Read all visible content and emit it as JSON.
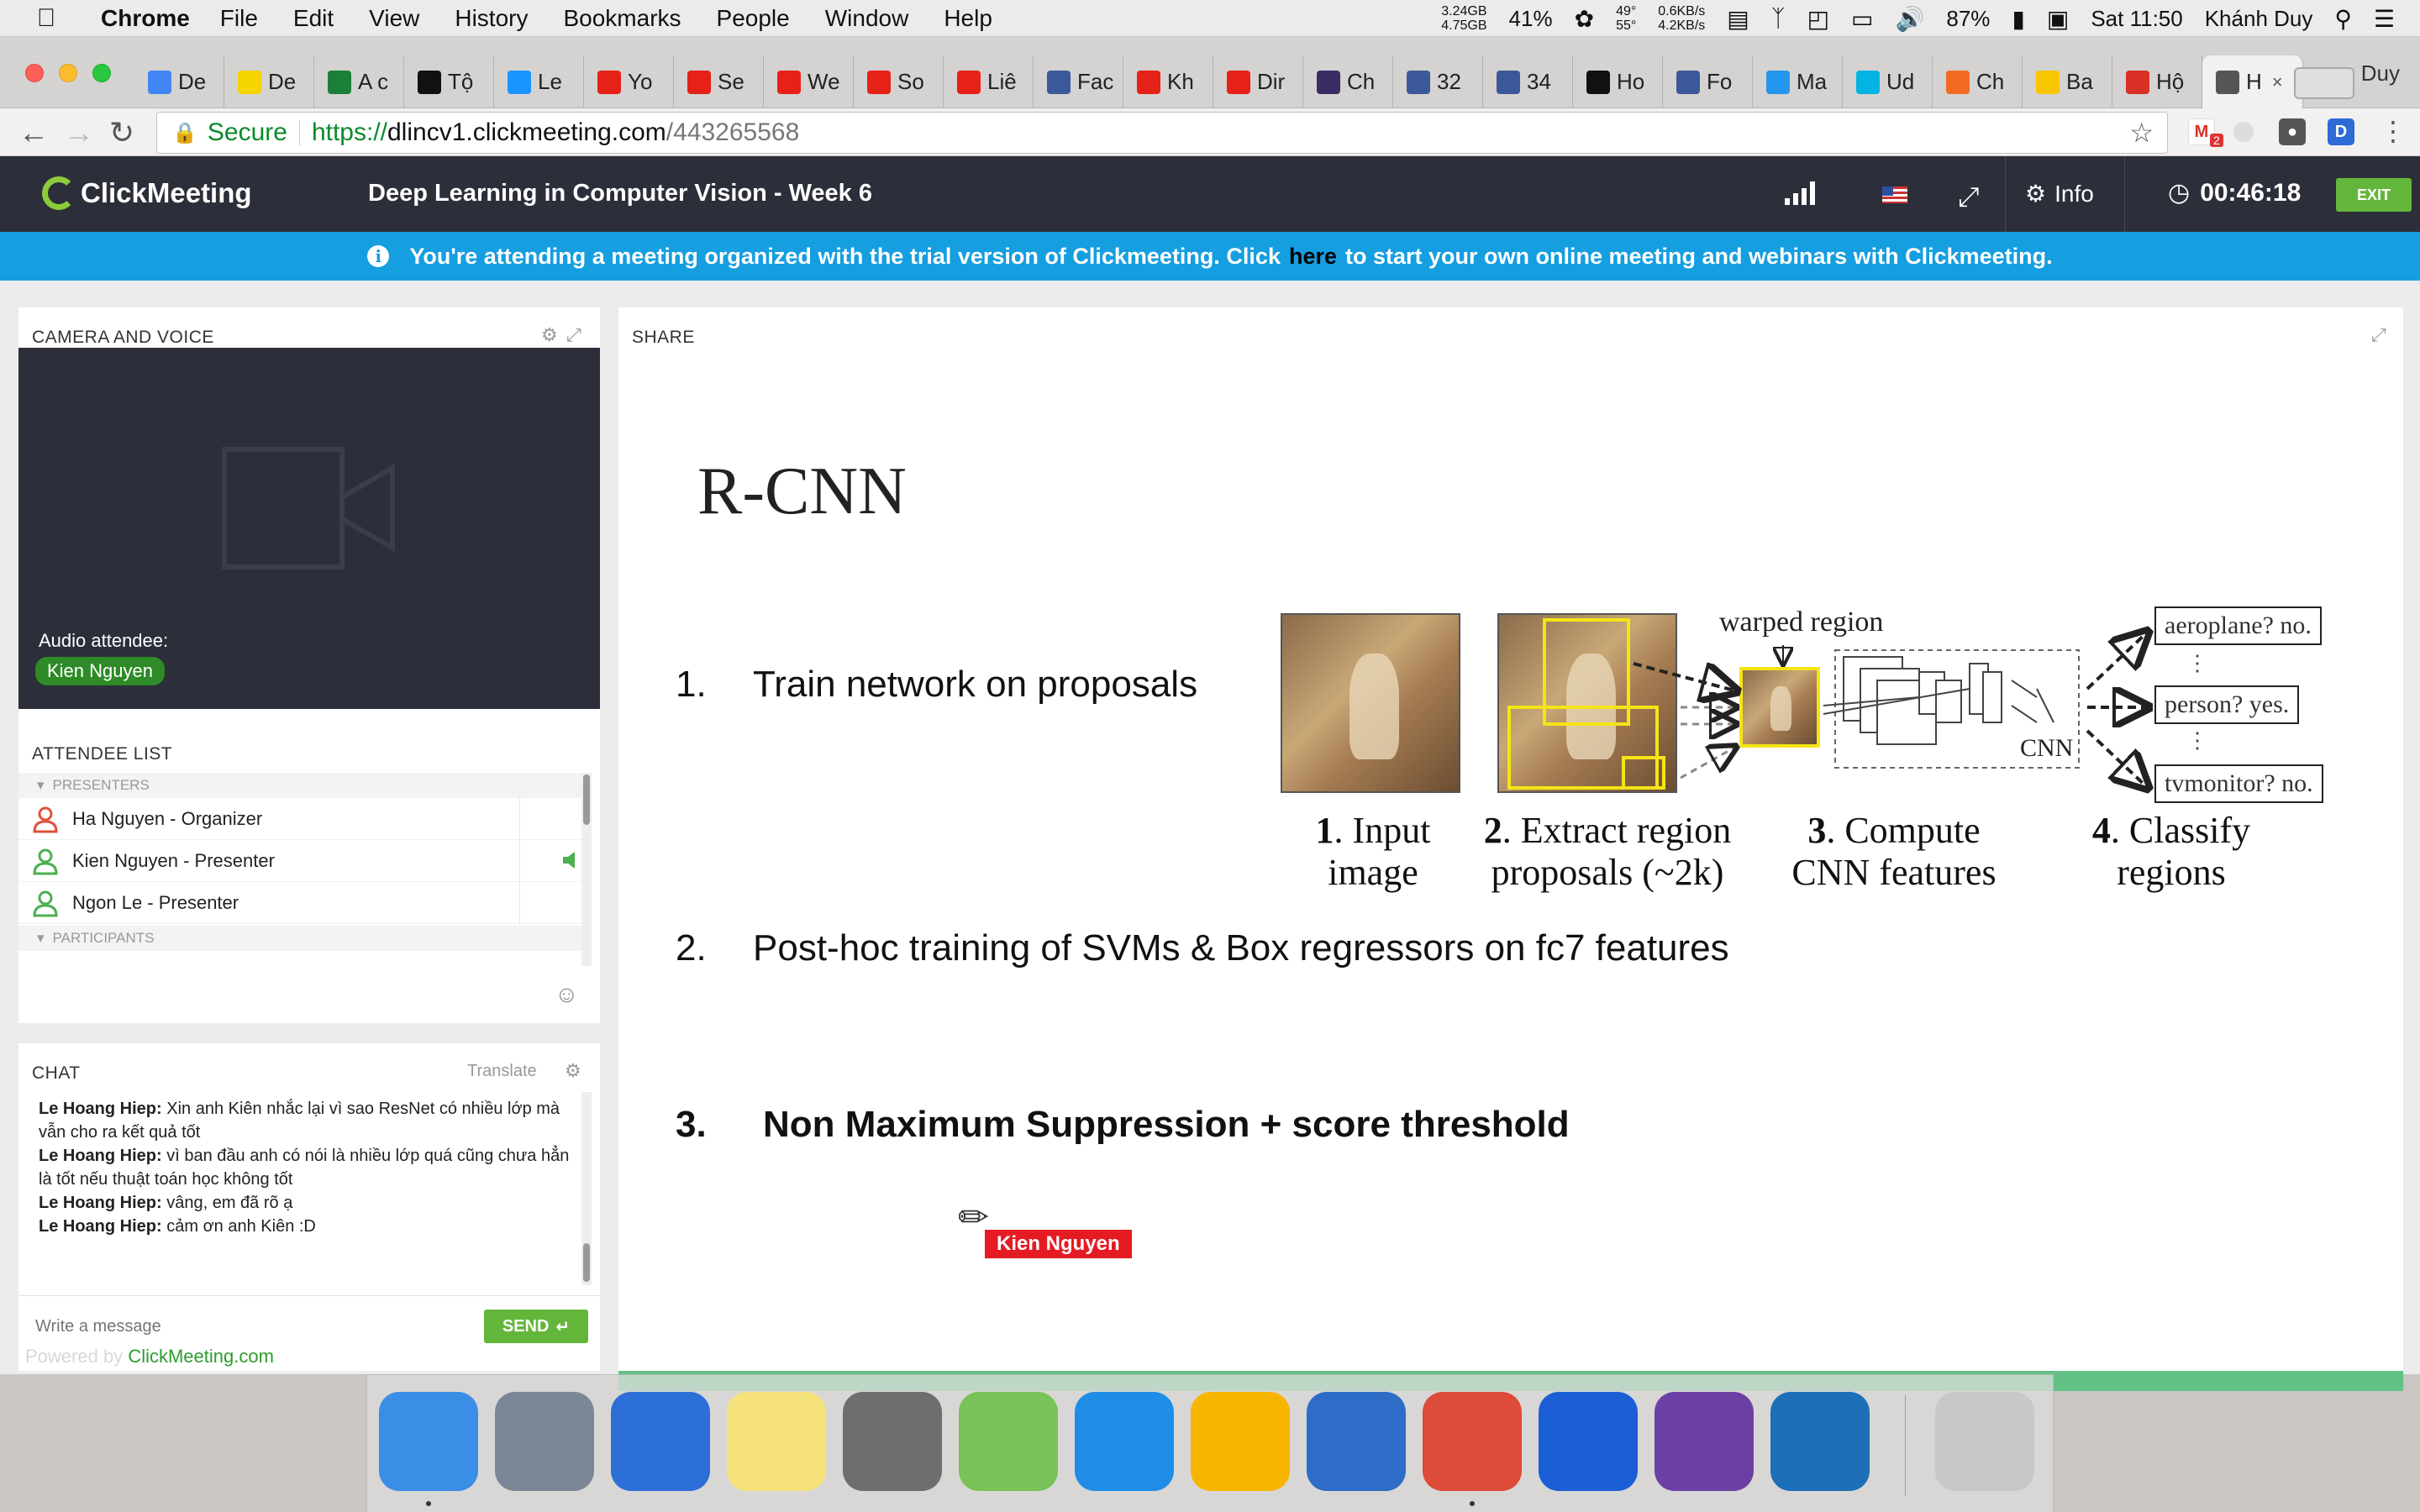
{
  "menubar": {
    "app_name": "Chrome",
    "menus": [
      "File",
      "Edit",
      "View",
      "History",
      "Bookmarks",
      "People",
      "Window",
      "Help"
    ],
    "mem_top": "3.24GB",
    "mem_bottom": "4.75GB",
    "cpu": "41%",
    "temp_top": "49°",
    "temp_bottom": "55°",
    "net_top": "0.6KB/s",
    "net_bottom": "4.2KB/s",
    "battery": "87%",
    "clock": "Sat 11:50",
    "user": "Khánh Duy"
  },
  "tabs": [
    {
      "label": "De",
      "icon": "google-icon",
      "color": "#4285f4"
    },
    {
      "label": "De",
      "icon": "smiley-icon",
      "color": "#f5d400"
    },
    {
      "label": "A c",
      "icon": "asterisk-icon",
      "color": "#1a7f37"
    },
    {
      "label": "Tộ",
      "icon": "stripe-icon",
      "color": "#111111"
    },
    {
      "label": "Le",
      "icon": "tiki-icon",
      "color": "#1a94ff"
    },
    {
      "label": "Yo",
      "icon": "youtube-icon",
      "color": "#e62117"
    },
    {
      "label": "Se",
      "icon": "youtube-icon",
      "color": "#e62117"
    },
    {
      "label": "We",
      "icon": "youtube-icon",
      "color": "#e62117"
    },
    {
      "label": "So",
      "icon": "youtube-icon",
      "color": "#e62117"
    },
    {
      "label": "Liê",
      "icon": "youtube-icon",
      "color": "#e62117"
    },
    {
      "label": "Fac",
      "icon": "facebook-icon",
      "color": "#3b5998"
    },
    {
      "label": "Kh",
      "icon": "youtube-icon",
      "color": "#e62117"
    },
    {
      "label": "Dir",
      "icon": "youtube-icon",
      "color": "#e62117"
    },
    {
      "label": "Ch",
      "icon": "codepen-icon",
      "color": "#3a2d66"
    },
    {
      "label": "32",
      "icon": "facebook-icon",
      "color": "#3b5998"
    },
    {
      "label": "34",
      "icon": "facebook-icon",
      "color": "#3b5998"
    },
    {
      "label": "Ho",
      "icon": "medium-icon",
      "color": "#111111"
    },
    {
      "label": "Fo",
      "icon": "facebook-icon",
      "color": "#3b5998"
    },
    {
      "label": "Ma",
      "icon": "docker-icon",
      "color": "#2496ed"
    },
    {
      "label": "Ud",
      "icon": "udacity-icon",
      "color": "#02b3e4"
    },
    {
      "label": "Ch",
      "icon": "orange-icon",
      "color": "#f26b21"
    },
    {
      "label": "Ba",
      "icon": "b-icon",
      "color": "#f7c600"
    },
    {
      "label": "Hộ",
      "icon": "gmail-icon",
      "color": "#d93025"
    },
    {
      "label": "H",
      "icon": "speaker-icon",
      "color": "#555555",
      "active": true
    }
  ],
  "profile_name": "Duy",
  "url": {
    "secure_label": "Secure",
    "scheme": "https://",
    "host": "dlincv1.clickmeeting.com",
    "path": "/443265568"
  },
  "header": {
    "logo": "ClickMeeting",
    "title": "Deep Learning in Computer Vision - Week 6",
    "info_label": "Info",
    "timer": "00:46:18",
    "exit_label": "EXIT"
  },
  "banner": {
    "text_before": "You're attending a meeting organized with the trial version of Clickmeeting. Click",
    "link": "here",
    "text_after": "to start your own online meeting and webinars with Clickmeeting."
  },
  "camera": {
    "title": "CAMERA AND VOICE",
    "audio_label": "Audio attendee:",
    "audio_name": "Kien Nguyen"
  },
  "attendees": {
    "title": "ATTENDEE LIST",
    "presenters_label": "PRESENTERS",
    "participants_label": "PARTICIPANTS",
    "people": [
      {
        "name": "Ha Nguyen  - Organizer",
        "color": "#e0523b"
      },
      {
        "name": "Kien Nguyen  - Presenter",
        "color": "#4caf50"
      },
      {
        "name": "Ngon Le  - Presenter",
        "color": "#4caf50"
      }
    ]
  },
  "chat": {
    "title": "CHAT",
    "translate": "Translate",
    "messages": [
      {
        "author": "Le Hoang Hiep:",
        "text": " Xin anh Kiên nhắc lại vì sao ResNet có nhiều lớp mà vẫn cho ra kết quả tốt"
      },
      {
        "author": "Le Hoang Hiep:",
        "text": " vì ban đầu anh có nói là nhiều lớp quá cũng chưa hẳn là tốt nếu thuật toán học không tốt"
      },
      {
        "author": "Le Hoang Hiep:",
        "text": " vâng, em đã rõ ạ"
      },
      {
        "author": "Le Hoang Hiep:",
        "text": " cảm ơn anh Kiên :D"
      }
    ],
    "placeholder": "Write a message",
    "send_label": "SEND"
  },
  "powered": {
    "prefix": "Powered by",
    "brand": "ClickMeeting.com"
  },
  "share": {
    "title": "SHARE",
    "slide_title": "R-CNN",
    "items": [
      {
        "num": "1.",
        "text": "Train network on proposals"
      },
      {
        "num": "2.",
        "text": "Post-hoc training of SVMs & Box regressors on fc7 features"
      },
      {
        "num": "3.",
        "text": "Non Maximum Suppression + score threshold"
      }
    ],
    "figure": {
      "warped_label": "warped region",
      "cnn_label": "CNN",
      "step1_num": "1",
      "step1": ". Input image",
      "step2_num": "2",
      "step2": ". Extract region proposals (~2k)",
      "step3_num": "3",
      "step3": ". Compute CNN features",
      "step4_num": "4",
      "step4": ". Classify regions",
      "class1": "aeroplane? no.",
      "class2": "person? yes.",
      "class3": "tvmonitor? no."
    },
    "pointer_label": "Kien Nguyen"
  },
  "dock": [
    {
      "name": "finder-icon",
      "color": "#3a8ee6"
    },
    {
      "name": "launchpad-icon",
      "color": "#7b8797"
    },
    {
      "name": "itunes-icon",
      "color": "#2c6fd6"
    },
    {
      "name": "notes-icon",
      "color": "#f6e27a"
    },
    {
      "name": "system-preferences-icon",
      "color": "#6e6e6e"
    },
    {
      "name": "android-studio-icon",
      "color": "#78c257"
    },
    {
      "name": "xcode-icon",
      "color": "#1f8de6"
    },
    {
      "name": "sketch-icon",
      "color": "#f7b500"
    },
    {
      "name": "vmware-icon",
      "color": "#2d6cc7"
    },
    {
      "name": "chrome-icon",
      "color": "#dd4b39"
    },
    {
      "name": "sourcetree-icon",
      "color": "#1c5ed6"
    },
    {
      "name": "visual-studio-icon",
      "color": "#6b3fa3"
    },
    {
      "name": "vscode-icon",
      "color": "#1d6fb8"
    },
    {
      "name": "trash-icon",
      "color": "#c8c8c8"
    }
  ]
}
